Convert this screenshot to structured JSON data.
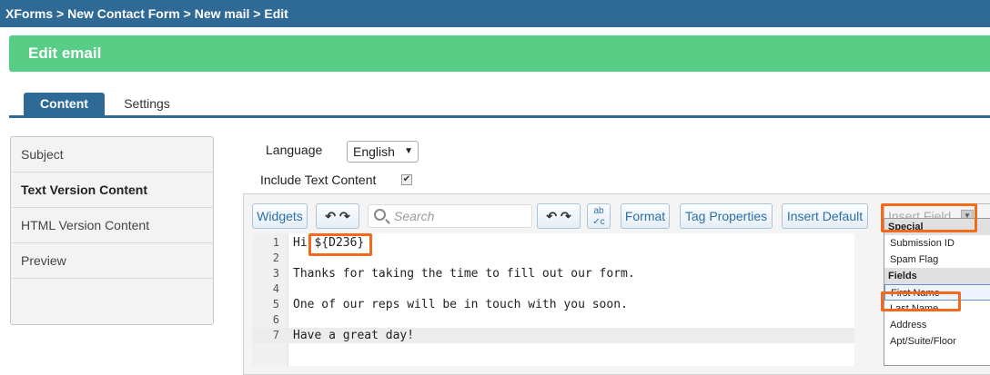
{
  "breadcrumb": "XForms > New Contact Form > New mail > Edit",
  "header": {
    "title": "Edit email"
  },
  "tabs": [
    {
      "label": "Content",
      "active": true
    },
    {
      "label": "Settings",
      "active": false
    }
  ],
  "sidebar": {
    "items": [
      {
        "label": "Subject",
        "active": false
      },
      {
        "label": "Text Version Content",
        "active": true
      },
      {
        "label": "HTML Version Content",
        "active": false
      },
      {
        "label": "Preview",
        "active": false
      }
    ]
  },
  "form": {
    "language_label": "Language",
    "language_value": "English",
    "include_label": "Include Text Content",
    "include_checked": true
  },
  "toolbar": {
    "widgets": "Widgets",
    "search_placeholder": "Search",
    "format": "Format",
    "tag_properties": "Tag Properties",
    "insert_default": "Insert Default",
    "insert_field": "Insert Field"
  },
  "editor": {
    "lines": [
      {
        "num": "1",
        "text": "Hi ${D236}"
      },
      {
        "num": "2",
        "text": ""
      },
      {
        "num": "3",
        "text": "Thanks for taking the time to fill out our form."
      },
      {
        "num": "4",
        "text": ""
      },
      {
        "num": "5",
        "text": "One of our reps will be in touch with you soon."
      },
      {
        "num": "6",
        "text": ""
      },
      {
        "num": "7",
        "text": "Have a great day!"
      }
    ],
    "highlighted_line": 7
  },
  "insert_dropdown": {
    "groups": [
      {
        "label": "Special",
        "options": [
          "Submission ID",
          "Spam Flag"
        ]
      },
      {
        "label": "Fields",
        "options": [
          "First Name",
          "Last Name",
          "Address",
          "Apt/Suite/Floor"
        ]
      }
    ],
    "selected": "First Name"
  },
  "colors": {
    "topbar": "#2f6996",
    "header": "#57cd85",
    "highlight": "#f26a1b"
  }
}
